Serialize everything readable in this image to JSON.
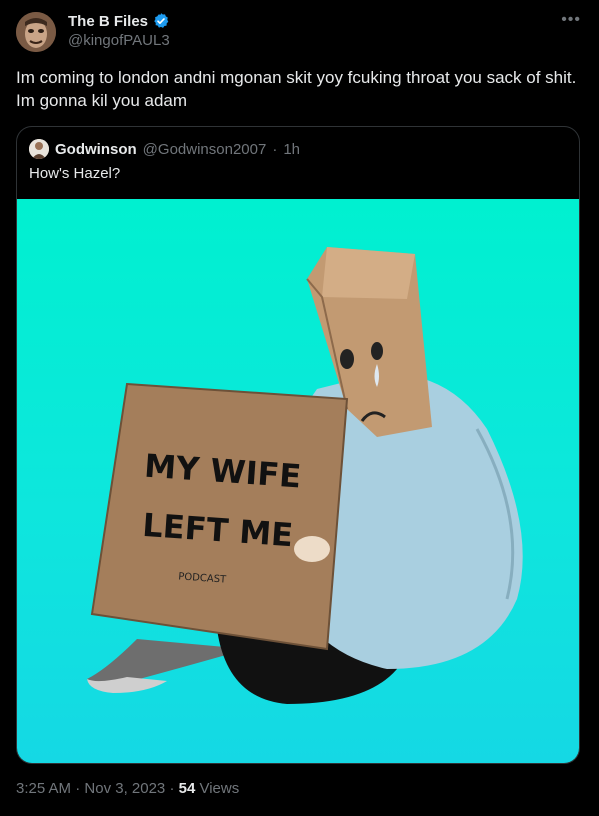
{
  "author": {
    "name": "The B Files",
    "handle": "@kingofPAUL3",
    "verified_color": "#1d9bf0"
  },
  "more_icon": "•••",
  "tweet": {
    "text": "Im coming to london andni mgonan skit yoy fcuking throat you sack of shit. Im gonna kil you adam"
  },
  "quote": {
    "name": "Godwinson",
    "handle": "@Godwinson2007",
    "separator": "·",
    "time": "1h",
    "text": "How's Hazel?",
    "image": {
      "sign_line1": "MY WIFE",
      "sign_line2": "LEFT ME",
      "sign_small": "PODCAST",
      "background": "#00f0d0"
    }
  },
  "footer": {
    "time": "3:25 AM",
    "dot1": "·",
    "date": "Nov 3, 2023",
    "dot2": "·",
    "views_count": "54",
    "views_label": "Views"
  }
}
